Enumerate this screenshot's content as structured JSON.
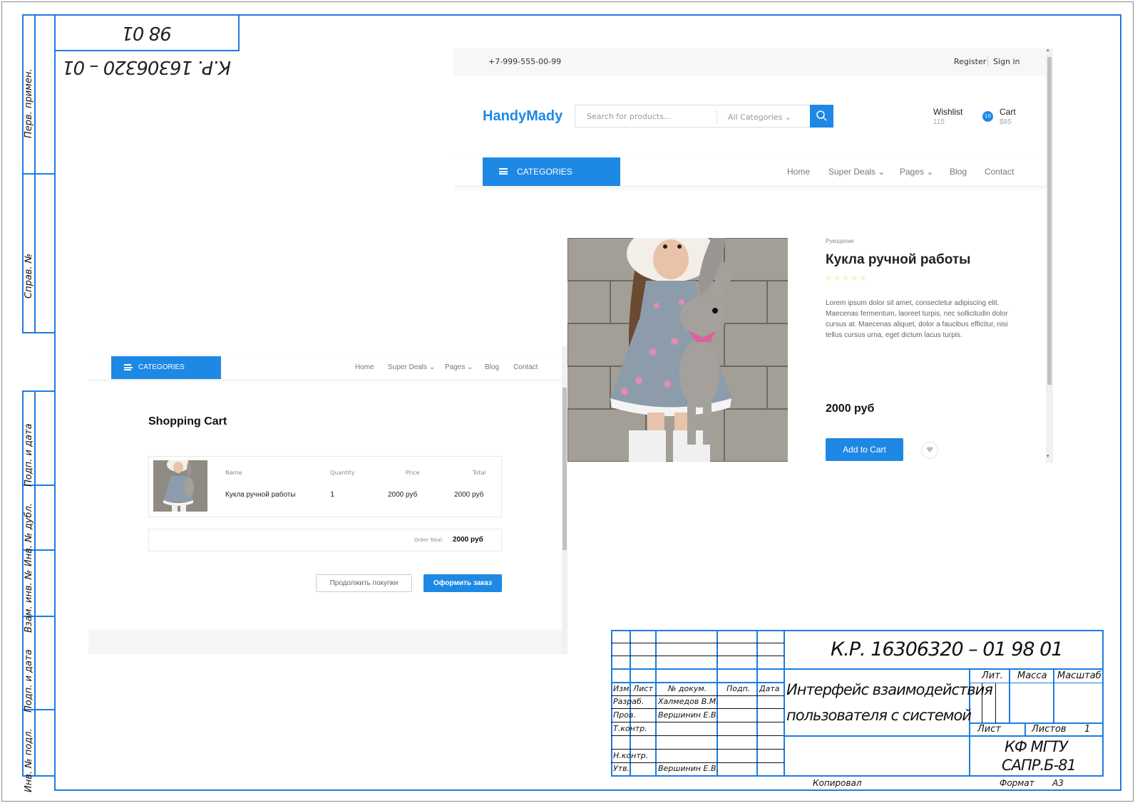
{
  "drawing_code": "К.Р. 16306320 – 01 98 01",
  "drawing_code_mirrored": "К.Р. 16306320 – 01 98 01",
  "left_margin": {
    "labels": [
      "Перв. примен.",
      "Справ. №",
      "Подп. и дата",
      "Инв. № дубл.",
      "Взам. инв. №",
      "Подп. и дата",
      "Инв. № подл."
    ]
  },
  "product_page": {
    "phone": "+7-999-555-00-99",
    "register": "Register",
    "sign_in": "Sign in",
    "logo": "HandyMady",
    "search_placeholder": "Search for products...",
    "categories_select": "All Categories",
    "wishlist_label": "Wishlist",
    "wishlist_count": "115",
    "cart_label": "Cart",
    "cart_badge": "10",
    "cart_total": "$85",
    "categories_button": "CATEGORIES",
    "nav": [
      "Home",
      "Super Deals",
      "Pages",
      "Blog",
      "Contact"
    ],
    "product": {
      "category": "Рукоделие",
      "name": "Кукла ручной работы",
      "rating_stars": 5,
      "rating_filled": 0,
      "description": "Lorem ipsum dolor sit amet, consectetur adipiscing elit. Maecenas fermentum, laoreet turpis, nec sollicitudin dolor cursus at. Maecenas aliquet, dolor a faucibus efficitur, nisi tellus cursus urna, eget dictum lacus turpis.",
      "price": "2000 руб",
      "add_to_cart": "Add to Cart"
    }
  },
  "cart_page": {
    "categories_button": "CATEGORIES",
    "nav": [
      "Home",
      "Super Deals",
      "Pages",
      "Blog",
      "Contact"
    ],
    "title": "Shopping Cart",
    "columns": [
      "Name",
      "Quantity",
      "Price",
      "Total"
    ],
    "row": {
      "name": "Кукла ручной работы",
      "quantity": "1",
      "price": "2000 руб",
      "total": "2000 руб"
    },
    "order_total_label": "Order Total:",
    "order_total_value": "2000 руб",
    "continue_button": "Продолжить покупки",
    "checkout_button": "Оформить заказ"
  },
  "title_block": {
    "code": "К.Р. 16306320 – 01 98 01",
    "name_line1": "Интерфейс взаимодействия",
    "name_line2": "пользователя с системой",
    "col_headers": [
      "Изм.",
      "Лист",
      "№ докум.",
      "Подп.",
      "Дата"
    ],
    "roles": [
      "Разраб.",
      "Пров.",
      "Т.контр.",
      "",
      "Н.контр.",
      "Утв."
    ],
    "persons": [
      "Халмедов В.М.",
      "Вершинин Е.В.",
      "",
      "",
      "",
      "Вершинин Е.В."
    ],
    "lit": "Лит.",
    "mass": "Масса",
    "scale": "Масштаб",
    "sheet": "Лист",
    "sheets": "Листов",
    "sheets_count": "1",
    "org_line1": "КФ МГТУ",
    "org_line2": "САПР.Б-81",
    "copied": "Копировал",
    "format_label": "Формат",
    "format_value": "А3"
  }
}
